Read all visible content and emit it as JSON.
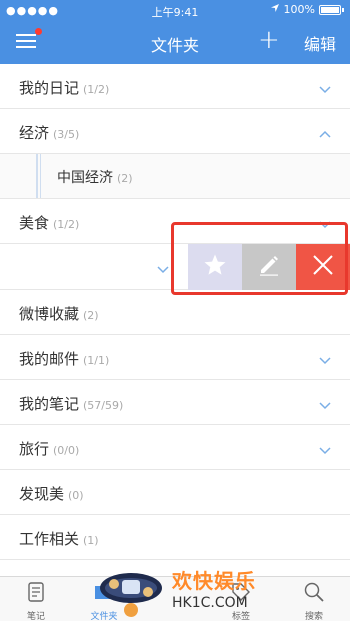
{
  "status_bar": {
    "carrier": "●●●●●",
    "time": "上午9:41",
    "battery": "100%"
  },
  "nav": {
    "title": "文件夹",
    "add": "+",
    "edit": "编辑"
  },
  "folders": [
    {
      "name": "我的日记",
      "count": "(1/2)",
      "chevron": "down"
    },
    {
      "name": "经济",
      "count": "(3/5)",
      "chevron": "up"
    },
    {
      "name": "中国经济",
      "count": "(2)",
      "sub": true
    },
    {
      "name": "美食",
      "count": "(1/2)",
      "chevron": "down"
    },
    {
      "name": "微博收藏",
      "count": "(2)"
    },
    {
      "name": "我的邮件",
      "count": "(1/1)",
      "chevron": "down"
    },
    {
      "name": "我的笔记",
      "count": "(57/59)",
      "chevron": "down"
    },
    {
      "name": "旅行",
      "count": "(0/0)",
      "chevron": "down"
    },
    {
      "name": "发现美",
      "count": "(0)"
    },
    {
      "name": "工作相关",
      "count": "(1)"
    }
  ],
  "swipe_actions": {
    "star_icon": "star-icon",
    "edit_icon": "pencil-icon",
    "delete_icon": "close-icon"
  },
  "tabs": [
    {
      "label": "笔记",
      "icon": "note-icon"
    },
    {
      "label": "文件夹",
      "icon": "folder-icon",
      "active": true
    },
    {
      "label": "标签",
      "icon": "tag-icon"
    },
    {
      "label": "搜索",
      "icon": "search-icon"
    }
  ],
  "watermark": {
    "title": "欢快娱乐",
    "url": "HK1C.COM"
  },
  "colors": {
    "accent": "#4a90e2",
    "delete": "#f05545",
    "highlight": "#e8382d"
  }
}
